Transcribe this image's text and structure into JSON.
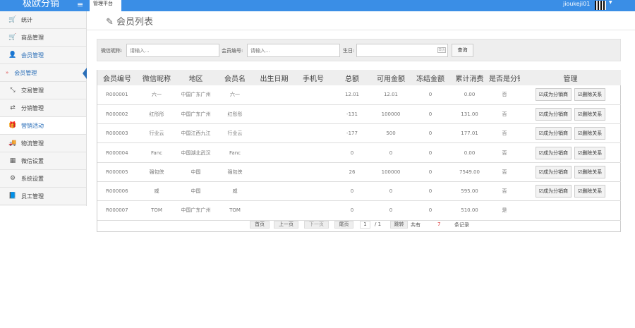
{
  "header": {
    "logo": "极欧分销",
    "tab": "管理平台",
    "user": "jioukeji01"
  },
  "sidebar": {
    "items": [
      {
        "label": "统计",
        "icon": "cart-icon"
      },
      {
        "label": "商品管理",
        "icon": "cart-icon"
      },
      {
        "label": "会员管理",
        "icon": "user-icon"
      },
      {
        "label": "会员管理",
        "icon": "chevron-right-icon",
        "sub": true
      },
      {
        "label": "交易管理",
        "icon": "compress-icon"
      },
      {
        "label": "分销管理",
        "icon": "shuffle-icon"
      },
      {
        "label": "营销活动",
        "icon": "gift-icon"
      },
      {
        "label": "物流管理",
        "icon": "truck-icon"
      },
      {
        "label": "微信设置",
        "icon": "qrcode-icon"
      },
      {
        "label": "系统设置",
        "icon": "gear-icon"
      },
      {
        "label": "员工管理",
        "icon": "book-icon"
      }
    ]
  },
  "page": {
    "title": "会员列表"
  },
  "search": {
    "nickname_label": "微信昵称:",
    "nickname_placeholder": "请输入...",
    "id_label": "会员编号:",
    "id_placeholder": "请输入...",
    "birthday_label": "生日:",
    "date_icon": "日历",
    "query": "查询"
  },
  "table": {
    "headers": [
      "会员编号",
      "微信昵称",
      "地区",
      "会员名",
      "出生日期",
      "手机号",
      "总额",
      "可用金额",
      "冻结金额",
      "累计消费",
      "是否是分销商",
      "管理"
    ],
    "rows": [
      [
        "R000001",
        "六一",
        "中国广东广州",
        "六一",
        "",
        "",
        "12.01",
        "12.01",
        "0",
        "0.00",
        "否"
      ],
      [
        "R000002",
        "红彤彤",
        "中国广东广州",
        "红彤彤",
        "",
        "",
        "-131",
        "100000",
        "0",
        "131.00",
        "否"
      ],
      [
        "R000003",
        "行业云",
        "中国江西九江",
        "行业云",
        "",
        "",
        "-177",
        "500",
        "0",
        "177.01",
        "否"
      ],
      [
        "R000004",
        "Fanc",
        "中国湖北武汉",
        "Fanc",
        "",
        "",
        "0",
        "0",
        "0",
        "0.00",
        "否"
      ],
      [
        "R000005",
        "强包侠",
        "中国",
        "强包侠",
        "",
        "",
        "26",
        "100000",
        "0",
        "7549.00",
        "否"
      ],
      [
        "R000006",
        "威",
        "中国",
        "威",
        "",
        "",
        "0",
        "0",
        "0",
        "595.00",
        "否"
      ],
      [
        "R000007",
        "TOM",
        "中国广东广州",
        "TOM",
        "",
        "",
        "0",
        "0",
        "0",
        "510.00",
        "是"
      ]
    ],
    "actions": {
      "become": "☑成为分销商",
      "remove": "☑删除关系"
    }
  },
  "pager": {
    "first": "首页",
    "prev": "上一页",
    "next": "下一页",
    "last": "尾页",
    "page": "1",
    "total_pages": "/ 1",
    "jump": "跳转",
    "total_label": "共有",
    "count": "7",
    "records": "条记录"
  },
  "colors": {
    "brand": "#3a8ee6",
    "active": "#2a6eb8"
  }
}
